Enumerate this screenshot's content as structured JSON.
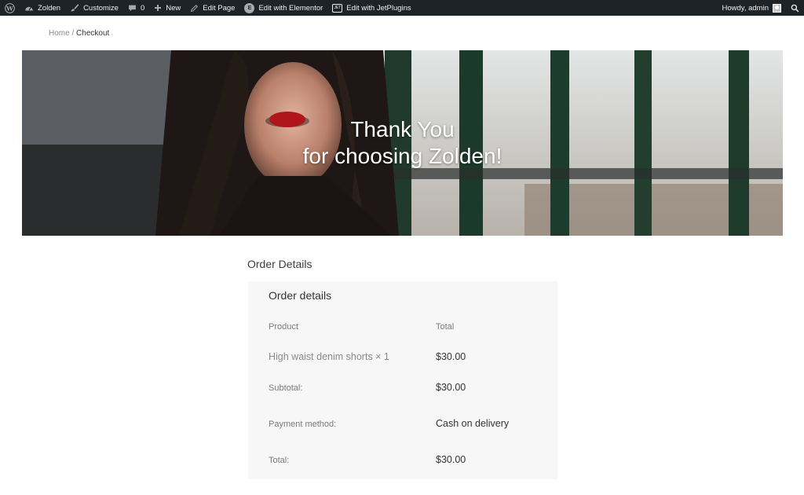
{
  "admin_bar": {
    "site_name": "Zolden",
    "customize": "Customize",
    "comments_count": "0",
    "new_label": "New",
    "edit_page": "Edit Page",
    "edit_elementor": "Edit with Elementor",
    "elementor_badge": "E",
    "edit_jetplugins": "Edit with JetPlugins",
    "jet_badge": "JET",
    "howdy": "Howdy, admin",
    "icons": [
      "wordpress-icon",
      "dashboard-icon",
      "brush-icon",
      "comment-icon",
      "plus-icon",
      "pencil-icon",
      "search-icon"
    ],
    "bg_color": "#1d2327"
  },
  "breadcrumb": {
    "home": "Home",
    "separator": "/",
    "current": "Checkout"
  },
  "hero": {
    "line1": "Thank You",
    "line2": "for choosing Zolden!"
  },
  "order": {
    "section_title": "Order Details",
    "card_title": "Order details",
    "col_product": "Product",
    "col_total": "Total",
    "item_name": "High waist denim shorts × 1",
    "item_total": "$30.00",
    "subtotal_label": "Subtotal:",
    "subtotal_value": "$30.00",
    "payment_label": "Payment method:",
    "payment_value": "Cash on delivery",
    "total_label": "Total:",
    "total_value": "$30.00"
  }
}
